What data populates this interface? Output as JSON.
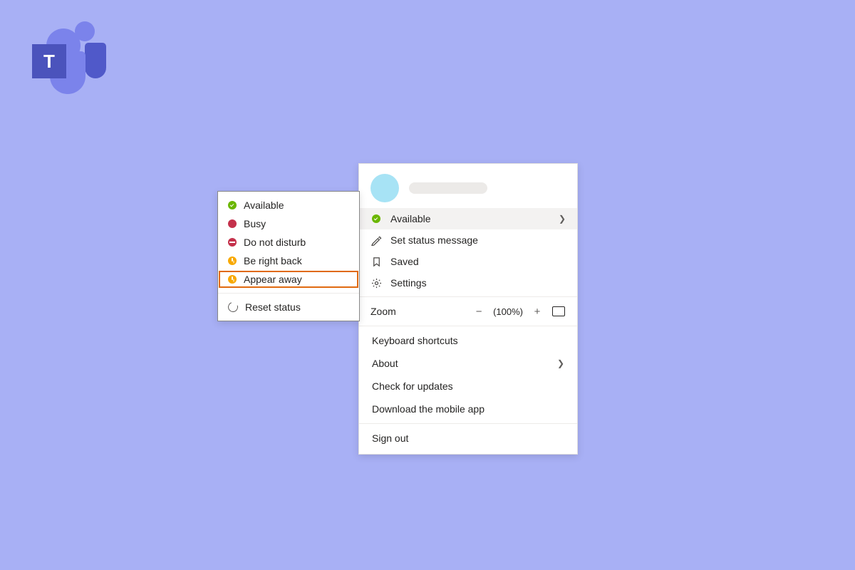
{
  "logo": {
    "letter": "T"
  },
  "statusMenu": {
    "items": [
      {
        "label": "Available"
      },
      {
        "label": "Busy"
      },
      {
        "label": "Do not disturb"
      },
      {
        "label": "Be right back"
      },
      {
        "label": "Appear away"
      }
    ],
    "reset": "Reset status"
  },
  "profileMenu": {
    "currentStatus": "Available",
    "setStatus": "Set status message",
    "saved": "Saved",
    "settings": "Settings",
    "zoom": {
      "label": "Zoom",
      "minus": "−",
      "percent": "(100%)",
      "plus": "+"
    },
    "keyboard": "Keyboard shortcuts",
    "about": "About",
    "updates": "Check for updates",
    "mobile": "Download the mobile app",
    "signout": "Sign out"
  }
}
